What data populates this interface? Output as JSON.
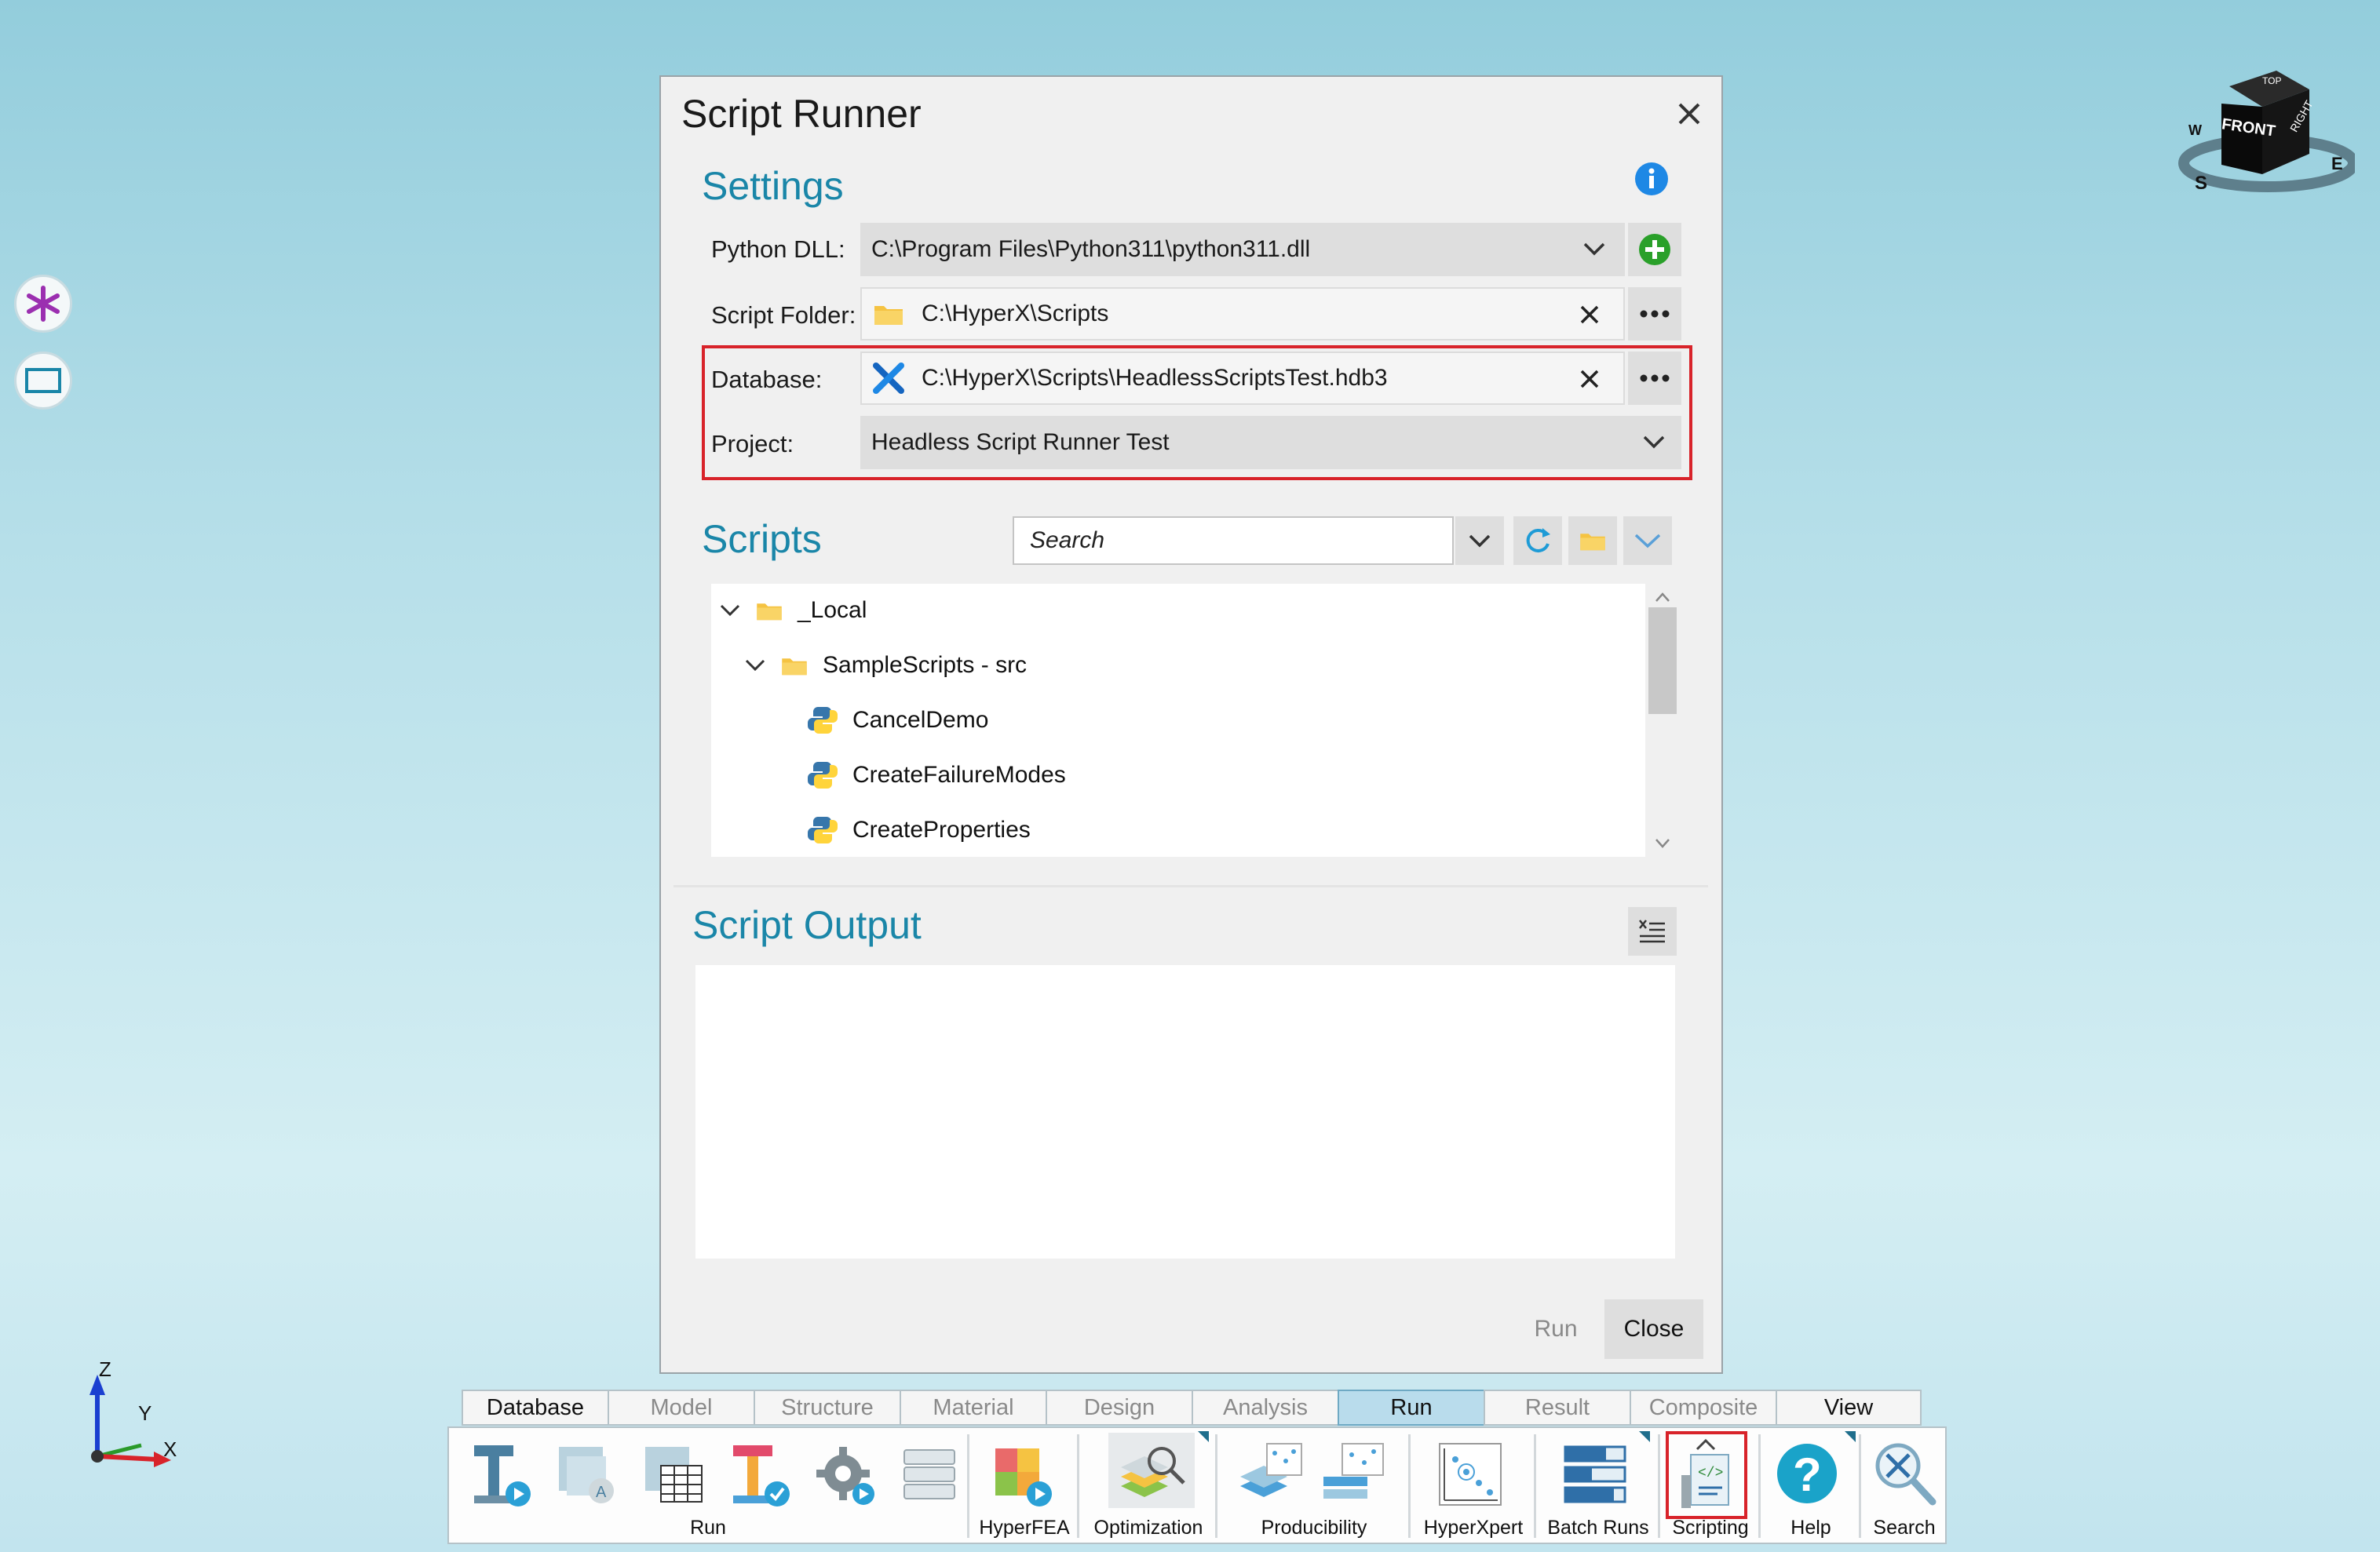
{
  "dialog": {
    "title": "Script Runner",
    "settings_heading": "Settings",
    "python_dll": {
      "label": "Python DLL:",
      "value": "C:\\Program Files\\Python311\\python311.dll"
    },
    "script_folder": {
      "label": "Script Folder:",
      "value": "C:\\HyperX\\Scripts"
    },
    "database": {
      "label": "Database:",
      "value": "C:\\HyperX\\Scripts\\HeadlessScriptsTest.hdb3"
    },
    "project": {
      "label": "Project:",
      "value": "Headless Script Runner Test"
    },
    "scripts_heading": "Scripts",
    "search": {
      "placeholder": "Search"
    },
    "tree": [
      {
        "label": "_Local",
        "type": "folder",
        "level": 0,
        "expanded": true
      },
      {
        "label": "SampleScripts - src",
        "type": "folder",
        "level": 1,
        "expanded": true
      },
      {
        "label": "CancelDemo",
        "type": "script",
        "level": 2
      },
      {
        "label": "CreateFailureModes",
        "type": "script",
        "level": 2
      },
      {
        "label": "CreateProperties",
        "type": "script",
        "level": 2
      }
    ],
    "output_heading": "Script Output",
    "run_label": "Run",
    "close_label": "Close"
  },
  "ribbon": {
    "tabs": [
      {
        "label": "Database",
        "state": "normal-dark"
      },
      {
        "label": "Model",
        "state": "normal"
      },
      {
        "label": "Structure",
        "state": "normal"
      },
      {
        "label": "Material",
        "state": "normal"
      },
      {
        "label": "Design",
        "state": "normal"
      },
      {
        "label": "Analysis",
        "state": "normal"
      },
      {
        "label": "Run",
        "state": "active"
      },
      {
        "label": "Result",
        "state": "normal"
      },
      {
        "label": "Composite",
        "state": "normal"
      },
      {
        "label": "View",
        "state": "normal-dark"
      }
    ],
    "groups": {
      "run": "Run",
      "hyperfea": "HyperFEA",
      "optimization": "Optimization",
      "producibility": "Producibility",
      "hyperxpert": "HyperXpert",
      "batch_runs": "Batch Runs",
      "scripting": "Scripting",
      "help": "Help",
      "search": "Search"
    }
  },
  "view_cube": {
    "front": "FRONT",
    "right": "RIGHT",
    "top": "TOP",
    "compass_s": "S",
    "compass_e": "E",
    "compass_w": "W"
  },
  "axes": {
    "z": "Z",
    "y": "Y",
    "x": "X"
  },
  "colors": {
    "accent": "#1a86a8",
    "highlight": "#d8232a",
    "active_tab": "#b9dcec"
  }
}
